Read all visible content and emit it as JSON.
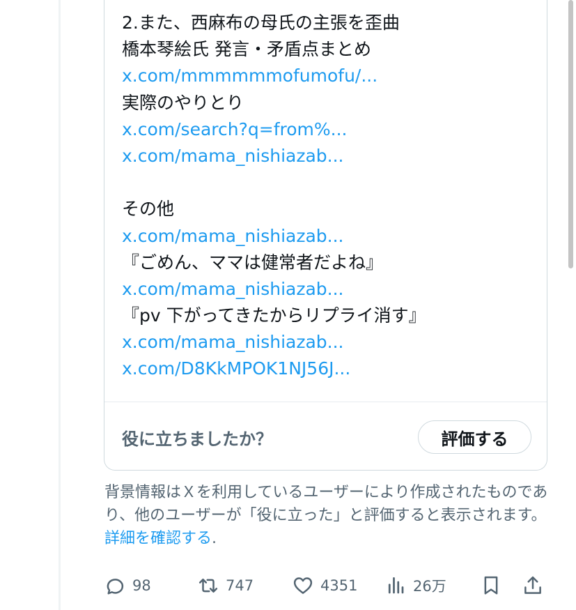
{
  "note": {
    "lines": [
      {
        "text": "2.また、西麻布の母氏の主張を歪曲",
        "link": false
      },
      {
        "text": "橋本琴絵氏 発言・矛盾点まとめ",
        "link": false
      },
      {
        "text": "x.com/mmmmmmofumofu/...",
        "link": true
      },
      {
        "text": "実際のやりとり",
        "link": false
      },
      {
        "text": "x.com/search?q=from%...",
        "link": true
      },
      {
        "text": "x.com/mama_nishiazab...",
        "link": true
      },
      {
        "text": "",
        "link": false
      },
      {
        "text": "その他",
        "link": false
      },
      {
        "text": "x.com/mama_nishiazab...",
        "link": true
      },
      {
        "text": "『ごめん、ママは健常者だよね』",
        "link": false
      },
      {
        "text": "x.com/mama_nishiazab...",
        "link": true
      },
      {
        "text": "『pv 下がってきたからリプライ消す』",
        "link": false
      },
      {
        "text": "x.com/mama_nishiazab...",
        "link": true
      },
      {
        "text": "x.com/D8KkMPOK1NJ56J...",
        "link": true
      }
    ]
  },
  "rating": {
    "question": "役に立ちましたか？",
    "button_label": "評価する"
  },
  "disclaimer": {
    "text": "背景情報はＸを利用しているユーザーにより作成されたものであり、他のユーザーが「役に立った」と評価すると表示されます。 ",
    "link_text": "詳細を確認する",
    "suffix": "."
  },
  "actions": {
    "reply": {
      "icon": "reply-icon",
      "count": "98"
    },
    "repost": {
      "icon": "repost-icon",
      "count": "747"
    },
    "like": {
      "icon": "heart-icon",
      "count": "4351"
    },
    "views": {
      "icon": "views-chart-icon",
      "count": "26万"
    },
    "bookmark": {
      "icon": "bookmark-icon"
    },
    "share": {
      "icon": "share-icon"
    }
  },
  "colors": {
    "link": "#1d9bf0",
    "text": "#0f1419",
    "secondary": "#536471",
    "border": "#cfd9de"
  }
}
